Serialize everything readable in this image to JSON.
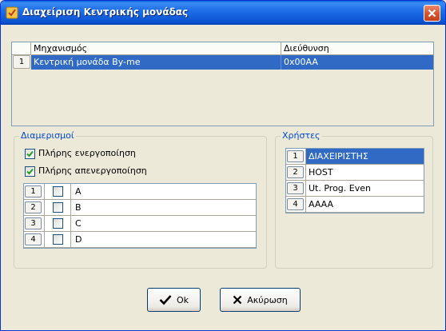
{
  "window": {
    "title": "Διαχείριση Κεντρικής μονάδας"
  },
  "devices": {
    "columns": [
      "Μηχανισμός",
      "Διεύθυνση"
    ],
    "rows": [
      {
        "index": "1",
        "name": "Κεντρική μονάδα By-me",
        "address": "0x00AA"
      }
    ]
  },
  "partitions": {
    "label": "Διαμερισμοί",
    "enable_all": "Πλήρης ενεργοποίηση",
    "disable_all": "Πλήρης απενεργοποίηση",
    "rows": [
      {
        "index": "1",
        "name": "A"
      },
      {
        "index": "2",
        "name": "B"
      },
      {
        "index": "3",
        "name": "C"
      },
      {
        "index": "4",
        "name": "D"
      }
    ]
  },
  "users": {
    "label": "Χρήστες",
    "rows": [
      {
        "index": "1",
        "name": "ΔΙΑΧΕΙΡΙΣΤΗΣ"
      },
      {
        "index": "2",
        "name": "HOST"
      },
      {
        "index": "3",
        "name": "Ut. Prog. Even"
      },
      {
        "index": "4",
        "name": "AAAA"
      }
    ]
  },
  "buttons": {
    "ok": "Ok",
    "cancel": "Ακύρωση"
  },
  "colors": {
    "selection": "#316ac5",
    "titlebar": "#0b54d2",
    "group_label": "#0046d5"
  }
}
